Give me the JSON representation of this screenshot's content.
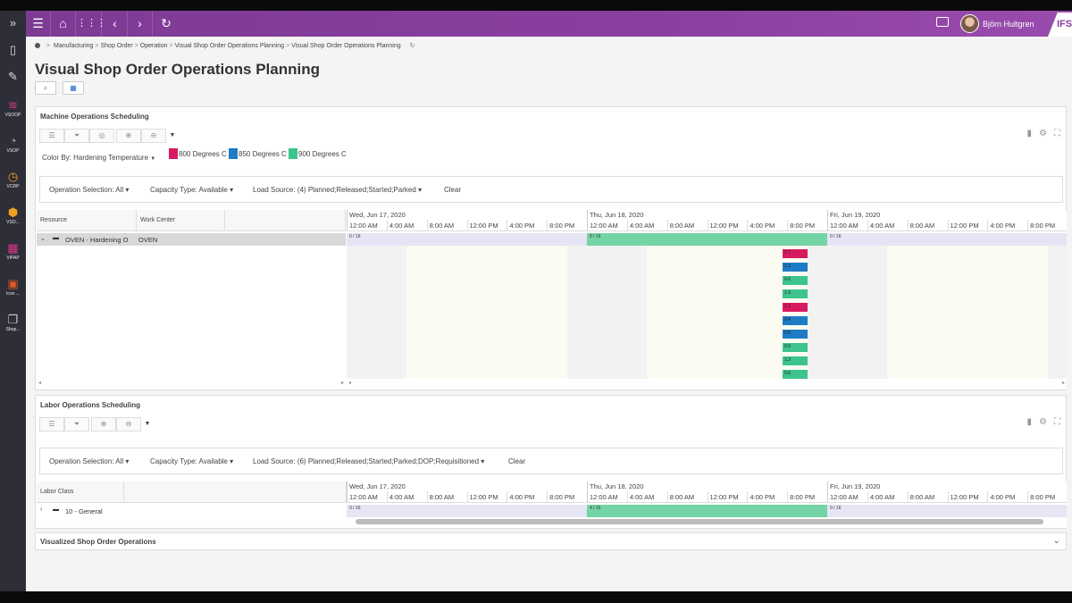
{
  "app": {
    "user_name": "Björn Hultgren",
    "logo_text": "IFS"
  },
  "sidebar": {
    "items": [
      {
        "label": "",
        "icon": "expand-icon"
      },
      {
        "label": "",
        "icon": "bookmark-icon"
      },
      {
        "label": "",
        "icon": "pencil-icon"
      },
      {
        "label": "VSOOP",
        "icon": "layers-icon",
        "color": "#d63a8a"
      },
      {
        "label": "VSOP",
        "icon": "pie-icon",
        "color": "#aaaaaa"
      },
      {
        "label": "VCRP",
        "icon": "gauge-icon",
        "color": "#f0a020"
      },
      {
        "label": "VSO...",
        "icon": "cube-icon",
        "color": "#f0a020"
      },
      {
        "label": "VIPAP",
        "icon": "grid-icon",
        "color": "#d63a8a"
      },
      {
        "label": "Icon ...",
        "icon": "image-icon",
        "color": "#e05a2a"
      },
      {
        "label": "Shop...",
        "icon": "copy-icon",
        "color": "#cccccc"
      }
    ]
  },
  "breadcrumb": {
    "items": [
      "Manufacturing",
      "Shop Order",
      "Operation",
      "Visual Shop Order Operations Planning",
      "Visual Shop Order Operations Planning"
    ]
  },
  "page": {
    "title": "Visual Shop Order Operations Planning"
  },
  "machine": {
    "title": "Machine Operations Scheduling",
    "color_by_label": "Color By: Hardening Temperature",
    "legend": [
      {
        "label": "800 Degrees C",
        "color": "#d81b60"
      },
      {
        "label": "850 Degrees C",
        "color": "#1e7bc6"
      },
      {
        "label": "900 Degrees C",
        "color": "#3cc48c"
      }
    ],
    "filters": {
      "operation_selection": "Operation Selection: All",
      "capacity_type": "Capacity Type: Available",
      "load_source": "Load Source: (4) Planned;Released;Started;Parked",
      "clear": "Clear"
    },
    "columns": {
      "resource": "Resource",
      "work_center": "Work Center"
    },
    "row": {
      "resource": "OVEN - Hardening O",
      "work_center": "OVEN"
    },
    "load": [
      "0 / 16",
      "8 / 16",
      "0 / 16"
    ],
    "operations": [
      {
        "label": "1.7",
        "color": "#d81b60"
      },
      {
        "label": "1.2",
        "color": "#1e7bc6"
      },
      {
        "label": "0.6",
        "color": "#3cc48c"
      },
      {
        "label": "1.3",
        "color": "#3cc48c"
      },
      {
        "label": "1.1",
        "color": "#d81b60"
      },
      {
        "label": "0.4",
        "color": "#1e7bc6"
      },
      {
        "label": "0.5",
        "color": "#1e7bc6"
      },
      {
        "label": "0.5",
        "color": "#3cc48c"
      },
      {
        "label": "1.3",
        "color": "#3cc48c"
      },
      {
        "label": "0.6",
        "color": "#3cc48c"
      }
    ]
  },
  "labor": {
    "title": "Labor Operations Scheduling",
    "filters": {
      "operation_selection": "Operation Selection: All",
      "capacity_type": "Capacity Type: Available",
      "load_source": "Load Source: (6) Planned;Released;Started;Parked;DOP;Requisitioned",
      "clear": "Clear"
    },
    "columns": {
      "labor_class": "Labor Class"
    },
    "row": {
      "labor_class": "10 - General"
    },
    "load": [
      "0 / 16",
      "4 / 16",
      "0 / 16"
    ]
  },
  "timeline": {
    "days": [
      "Wed, Jun 17, 2020",
      "Thu, Jun 18, 2020",
      "Fri, Jun 19, 2020"
    ],
    "hours": [
      "12:00 AM",
      "4:00 AM",
      "8:00 AM",
      "12:00 PM",
      "4:00 PM",
      "8:00 PM"
    ]
  },
  "visualized": {
    "title": "Visualized Shop Order Operations"
  }
}
